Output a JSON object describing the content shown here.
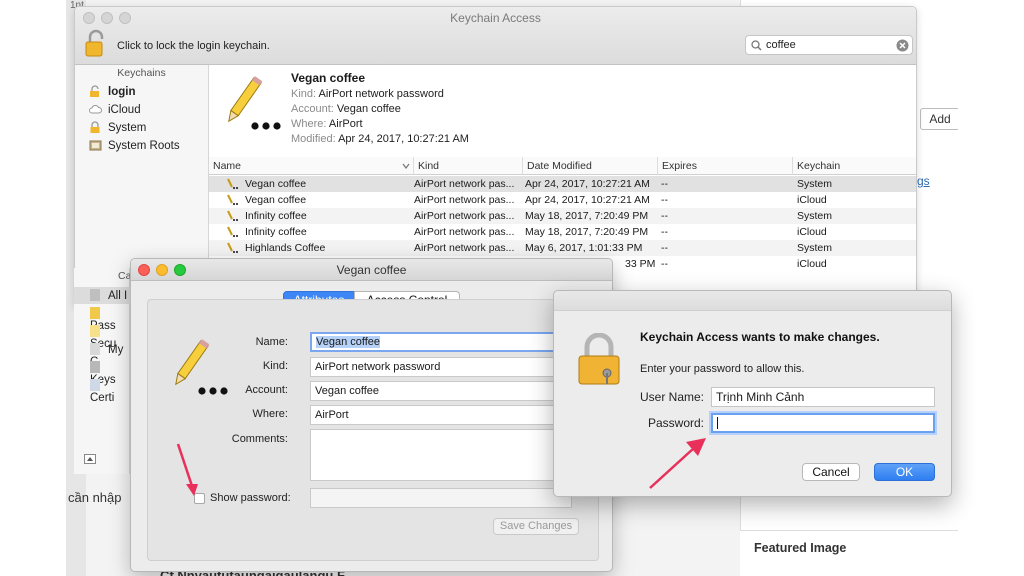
{
  "colors": {
    "accent": "#3d86f5",
    "arrow": "#e8305b"
  },
  "background": {
    "top_text": "1nt",
    "add_button": "Add",
    "link_text": "gs",
    "featured_image": "Featured Image",
    "cannhap_text": "cần nhập",
    "bottom_text": "Cf Nnyaututaungaiqaulangu F"
  },
  "keychain_window": {
    "title": "Keychain Access",
    "lock_text": "Click to lock the login keychain.",
    "search": {
      "value": "coffee",
      "icon": "magnifier-icon",
      "clear_icon": "clear-icon"
    },
    "sidebar": {
      "keychains_header": "Keychains",
      "keychains": [
        {
          "label": "login",
          "icon": "lock-open-icon"
        },
        {
          "label": "iCloud",
          "icon": "cloud-icon"
        },
        {
          "label": "System",
          "icon": "lock-icon"
        },
        {
          "label": "System Roots",
          "icon": "folder-icon"
        }
      ],
      "category_header": "Ca",
      "categories": [
        {
          "label": "All I"
        },
        {
          "label": "Pass"
        },
        {
          "label": "Secu"
        },
        {
          "label": "My C"
        },
        {
          "label": "Keys"
        },
        {
          "label": "Certi"
        }
      ]
    },
    "detail": {
      "name": "Vegan coffee",
      "kind_label": "Kind:",
      "kind": "AirPort network password",
      "account_label": "Account:",
      "account": "Vegan coffee",
      "where_label": "Where:",
      "where": "AirPort",
      "modified_label": "Modified:",
      "modified": "Apr 24, 2017, 10:27:21 AM"
    },
    "table": {
      "columns": [
        "Name",
        "Kind",
        "Date Modified",
        "Expires",
        "Keychain"
      ],
      "rows": [
        {
          "name": "Vegan coffee",
          "kind": "AirPort network pas...",
          "date": "Apr 24, 2017, 10:27:21 AM",
          "expires": "--",
          "keychain": "System"
        },
        {
          "name": "Vegan coffee",
          "kind": "AirPort network pas...",
          "date": "Apr 24, 2017, 10:27:21 AM",
          "expires": "--",
          "keychain": "iCloud"
        },
        {
          "name": "Infinity coffee",
          "kind": "AirPort network pas...",
          "date": "May 18, 2017, 7:20:49 PM",
          "expires": "--",
          "keychain": "System"
        },
        {
          "name": "Infinity coffee",
          "kind": "AirPort network pas...",
          "date": "May 18, 2017, 7:20:49 PM",
          "expires": "--",
          "keychain": "iCloud"
        },
        {
          "name": "Highlands Coffee",
          "kind": "AirPort network pas...",
          "date": "May 6, 2017, 1:01:33 PM",
          "expires": "--",
          "keychain": "System"
        },
        {
          "name": "",
          "kind": "",
          "date": "33 PM",
          "expires": "--",
          "keychain": "iCloud"
        }
      ]
    }
  },
  "item_window": {
    "title": "Vegan coffee",
    "tabs": {
      "attributes": "Attributes",
      "access_control": "Access Control"
    },
    "name_label": "Name:",
    "name_value": "Vegan coffee",
    "kind_label": "Kind:",
    "kind_value": "AirPort network password",
    "account_label": "Account:",
    "account_value": "Vegan coffee",
    "where_label": "Where:",
    "where_value": "AirPort",
    "comments_label": "Comments:",
    "show_password_label": "Show password:",
    "save_button": "Save Changes"
  },
  "auth_dialog": {
    "title": "Keychain Access wants to make changes.",
    "subtitle": "Enter your password to allow this.",
    "username_label": "User Name:",
    "username_value": "Trịnh Minh Cảnh",
    "password_label": "Password:",
    "password_value": "",
    "cancel_button": "Cancel",
    "ok_button": "OK"
  }
}
